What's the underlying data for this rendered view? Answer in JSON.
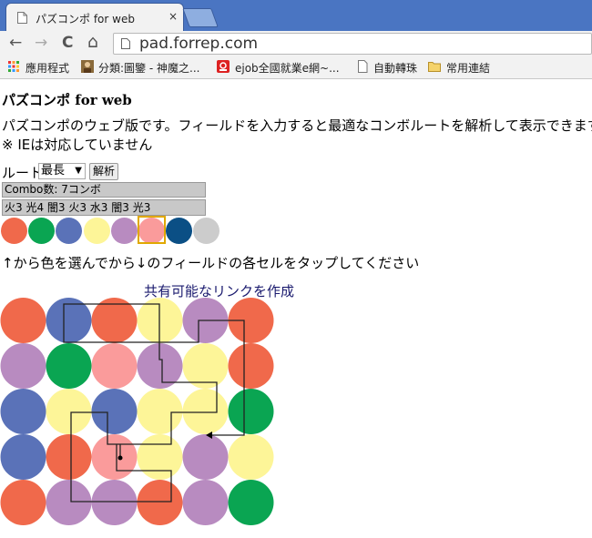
{
  "browser": {
    "tab_title": "パズコンポ for web",
    "tab_close": "×",
    "url": "pad.forrep.com",
    "nav": {
      "back": "←",
      "forward": "→",
      "reload": "C",
      "home": "⌂"
    },
    "bookmarks": [
      {
        "label": "應用程式",
        "icon": "apps-icon"
      },
      {
        "label": "分類:圖鑒 - 神魔之...",
        "icon": "avatar-icon"
      },
      {
        "label": "ejob全國就業e網~...",
        "icon": "ejob-icon"
      },
      {
        "label": "自動轉珠",
        "icon": "page-icon"
      },
      {
        "label": "常用連結",
        "icon": "folder-icon"
      }
    ]
  },
  "page": {
    "title_main": "パズコンポ",
    "title_suffix": " for web",
    "description": "パズコンポのウェブ版です。フィールドを入力すると最適なコンボルートを解析して表示できます。",
    "note": "※ IEは対応していません",
    "route_label": "ルート",
    "route_select_value": "最長",
    "route_select_arrow": "▼",
    "solve_button": "解析",
    "combo_count": "Combo数: 7コンボ",
    "combo_detail": "火3 光4 闇3 火3 水3 闇3 光3",
    "instruction": "↑から色を選んでから↓のフィールドの各セルをタップしてください",
    "share_link": "共有可能なリンクを作成"
  },
  "colors": {
    "fire": "#f0694b",
    "wood": "#0aa552",
    "water": "#5a72b8",
    "light": "#fdf598",
    "dark": "#b88bc0",
    "heart": "#fa9b9b",
    "jammer": "#0b4f85",
    "empty": "#cccccc",
    "selection": "#e0a800"
  },
  "palette": [
    "fire",
    "wood",
    "water",
    "light",
    "dark",
    "heart",
    "jammer",
    "empty"
  ],
  "palette_selected": 5,
  "board": [
    [
      "fire",
      "water",
      "fire",
      "light",
      "dark",
      "fire"
    ],
    [
      "dark",
      "wood",
      "heart",
      "dark",
      "light",
      "fire"
    ],
    [
      "water",
      "light",
      "water",
      "light",
      "light",
      "wood"
    ],
    [
      "water",
      "fire",
      "heart",
      "light",
      "dark",
      "light"
    ],
    [
      "fire",
      "dark",
      "dark",
      "fire",
      "dark",
      "wood"
    ]
  ]
}
